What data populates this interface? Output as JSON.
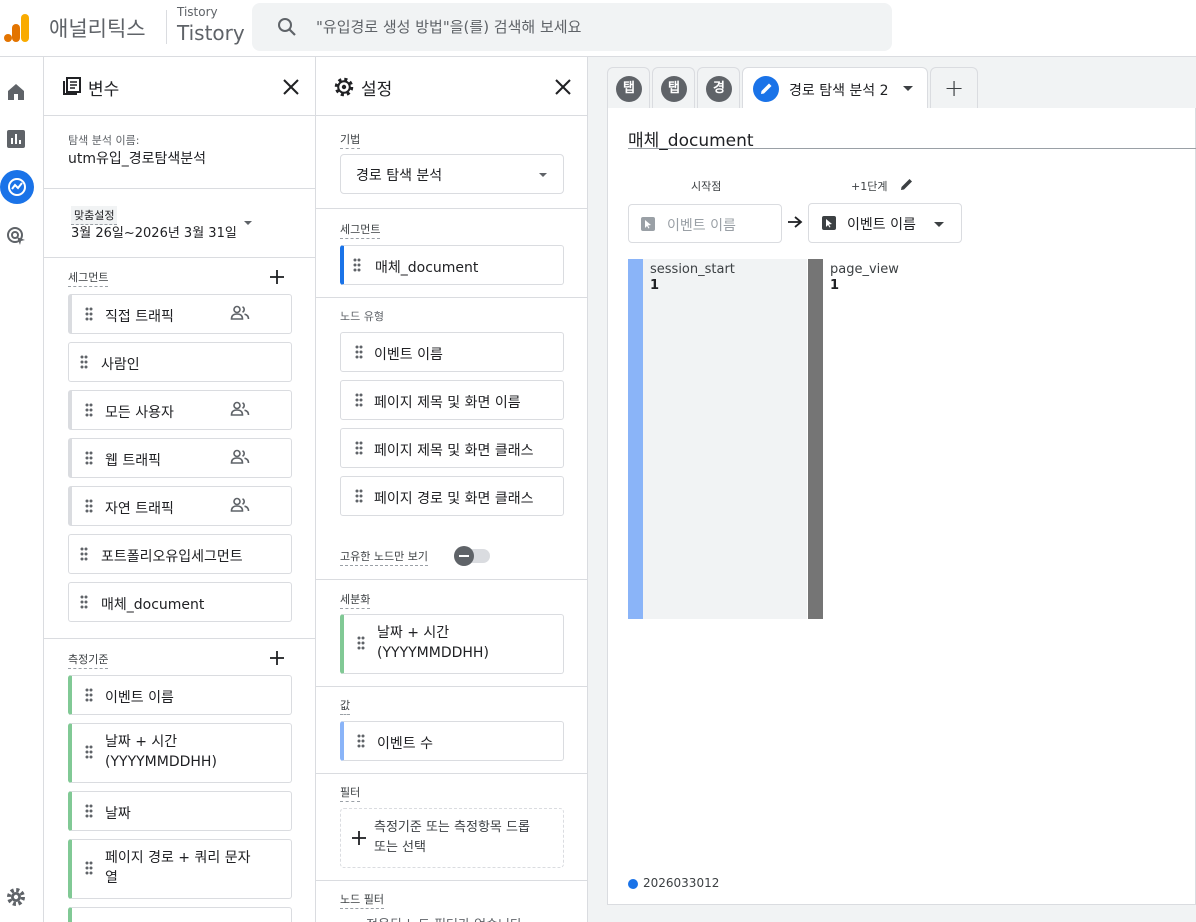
{
  "header": {
    "app_name": "애널리틱스",
    "property_small": "Tistory",
    "property_big": "Tistory",
    "search_placeholder": "\"유입경로 생성 방법\"을(를) 검색해 보세요"
  },
  "nav_rail": [
    "home-icon",
    "reports-icon",
    "explore-icon",
    "advertising-icon",
    "settings-icon"
  ],
  "variables_panel": {
    "title": "변수",
    "exploration_name_label": "탐색 분석 이름:",
    "exploration_name": "utm유입_경로탐색분석",
    "date_label": "맞춤설정",
    "date_range": "3월 26일~2026년 3월 31일",
    "segments_label": "세그먼트",
    "segments": [
      {
        "label": "직접 트래픽",
        "users_icon": true
      },
      {
        "label": "사람인",
        "users_icon": false
      },
      {
        "label": "모든 사용자",
        "users_icon": true
      },
      {
        "label": "웹 트래픽",
        "users_icon": true
      },
      {
        "label": "자연 트래픽",
        "users_icon": true
      },
      {
        "label": "포트폴리오유입세그먼트",
        "users_icon": false
      },
      {
        "label": "매체_document",
        "users_icon": false
      }
    ],
    "dimensions_label": "측정기준",
    "dimensions": [
      {
        "line1": "이벤트 이름",
        "line2": ""
      },
      {
        "line1": "날짜 + 시간",
        "line2": "(YYYYMMDDHH)"
      },
      {
        "line1": "날짜",
        "line2": ""
      },
      {
        "line1": "페이지 경로 + 쿼리 문자",
        "line2": "열"
      }
    ]
  },
  "settings_panel": {
    "title": "설정",
    "technique_label": "기법",
    "technique_value": "경로 탐색 분석",
    "segments_label": "세그먼트",
    "segment_value": "매체_document",
    "node_type_label": "노드 유형",
    "node_types": [
      "이벤트 이름",
      "페이지 제목 및 화면 이름",
      "페이지 제목 및 화면 클래스",
      "페이지 경로 및 화면 클래스"
    ],
    "unique_nodes_label": "고유한 노드만 보기",
    "unique_nodes_on": false,
    "breakdown_label": "세분화",
    "breakdown_line1": "날짜 + 시간",
    "breakdown_line2": "(YYYYMMDDHH)",
    "values_label": "값",
    "value_item": "이벤트 수",
    "filters_label": "필터",
    "filter_line1": "측정기준 또는 측정항목 드롭",
    "filter_line2": "또는 선택",
    "node_filter_label": "노드 필터",
    "node_filter_text": "적용된 노드 필터가 없습니다"
  },
  "canvas": {
    "tabs": [
      {
        "label": "탭"
      },
      {
        "label": "탭"
      },
      {
        "label": "경"
      }
    ],
    "active_tab": "경로 탐색 분석 2",
    "add_tab": "+",
    "exploration_title": "매체_document",
    "start_label": "시작점",
    "step_label": "+1단계",
    "start_node_placeholder": "이벤트 이름",
    "step_node_value": "이벤트 이름",
    "nodes": [
      {
        "name": "session_start",
        "value": "1"
      },
      {
        "name": "page_view",
        "value": "1"
      }
    ],
    "legend_item": "2026033012",
    "colors": {
      "start_bar": "#8ab4f8",
      "step_bar": "#757575",
      "accent": "#1a73e8"
    }
  }
}
